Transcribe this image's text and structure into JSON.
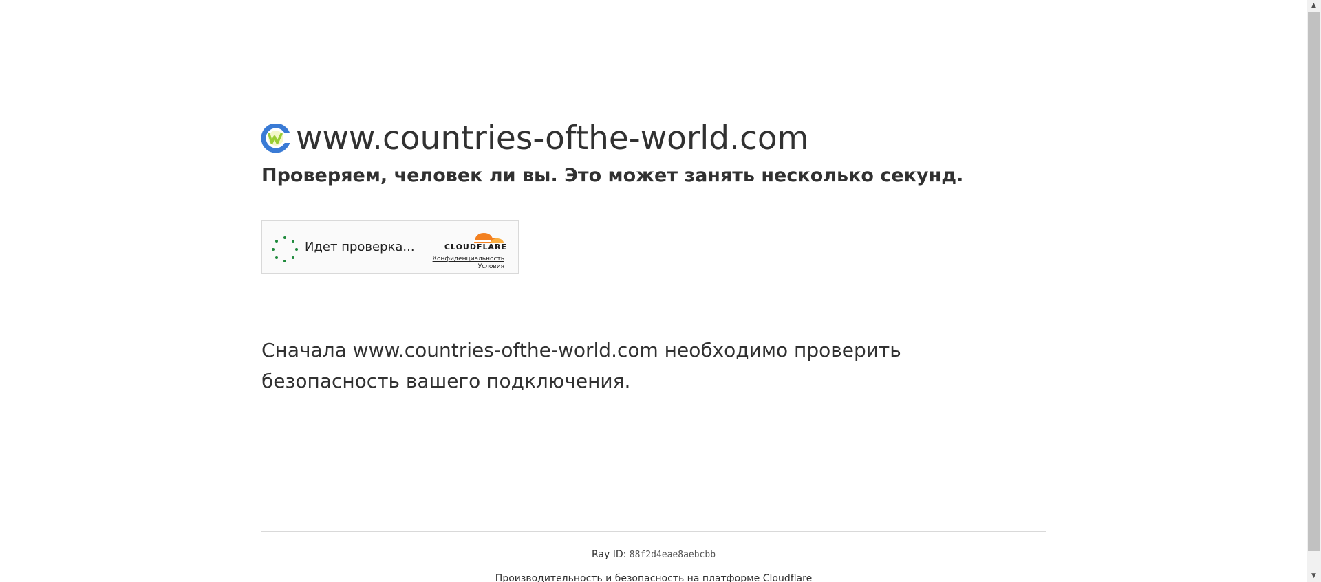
{
  "site": {
    "name": "www.countries-ofthe-world.com",
    "favicon_icon": "site-logo-icon"
  },
  "subtitle": "Проверяем, человек ли вы. Это может занять несколько секунд.",
  "widget": {
    "spinner_icon": "loading-spinner-icon",
    "label": "Идет проверка...",
    "brand": "CLOUDFLARE",
    "privacy_link": "Конфиденциальность",
    "terms_link": "Условия",
    "accent_color": "#f38020"
  },
  "description": "Сначала www.countries-ofthe-world.com необходимо проверить безопасность вашего подключения.",
  "footer": {
    "ray_label": "Ray ID:",
    "ray_id": "88f2d4eae8aebcbb",
    "performance_text": "Производительность и безопасность на платформе Cloudflare"
  },
  "scrollbar": {
    "up_arrow": "▲",
    "down_arrow": "▼"
  }
}
